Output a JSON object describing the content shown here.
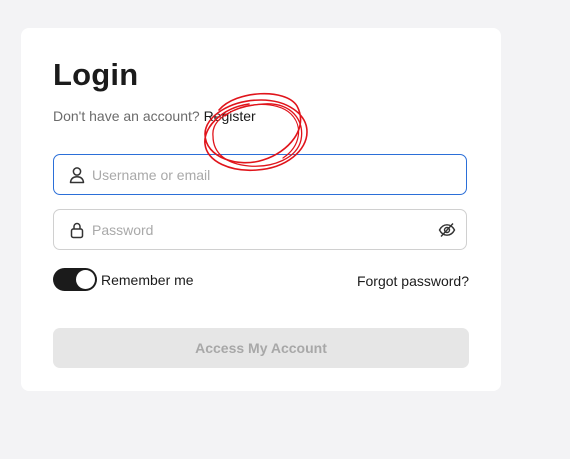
{
  "login": {
    "title": "Login",
    "no_account_text": "Don't have an account?",
    "register_label": "Register",
    "username_placeholder": "Username or email",
    "password_placeholder": "Password",
    "remember_label": "Remember me",
    "remember_checked": true,
    "forgot_label": "Forgot password?",
    "submit_label": "Access My Account",
    "submit_disabled": true
  },
  "icons": {
    "username": "user-icon",
    "password": "lock-icon",
    "visibility": "eye-off-icon"
  },
  "colors": {
    "background": "#f3f3f5",
    "card": "#ffffff",
    "focus_border": "#2b6fd8",
    "toggle_on": "#1b1b1b",
    "button_disabled_bg": "#e6e6e6",
    "button_disabled_text": "#a8a8a8",
    "annotation": "#e0141b"
  },
  "annotation": {
    "type": "hand-drawn-circle",
    "target": "register-link"
  }
}
